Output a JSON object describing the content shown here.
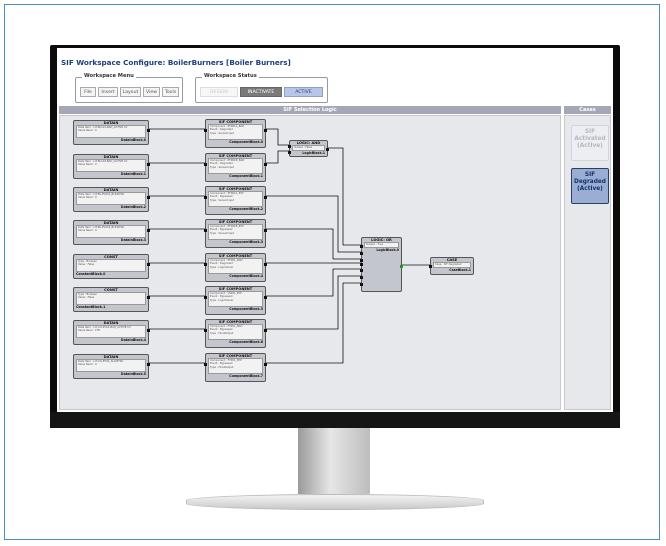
{
  "app": {
    "title": "SIF Workspace Configure: BoilerBurners [Boiler Burners]"
  },
  "workspace_menu": {
    "label": "Workspace Menu",
    "items": [
      "File",
      "Insert",
      "Layout",
      "View",
      "Tools"
    ]
  },
  "workspace_status": {
    "label": "Workspace Status",
    "items": [
      "DESIGN",
      "INACTIVATE",
      "ACTIVE"
    ]
  },
  "panels": {
    "logic_title": "SIF Selection Logic",
    "cases_title": "Cases"
  },
  "cases": [
    {
      "lines": [
        "SIF",
        "Activated",
        "(Active)"
      ],
      "state": "inactive"
    },
    {
      "lines": [
        "SIF",
        "Degraded",
        "(Active)"
      ],
      "state": "active"
    }
  ],
  "colors": {
    "title": "#1c3f7a",
    "panel_header": "#a4a8b6",
    "canvas": "#e6e8ec",
    "case_active": "#9aaed4",
    "status_active": "#b7c6e6",
    "status_inactivate": "#7a7a7a",
    "port_output": "#1e9a2a"
  },
  "data_blocks": [
    {
      "title": "DATAIN",
      "row1": "Data Item : LIT-BL101-BAD_ACTIVE.CV",
      "row2": "Value Read : 0",
      "name": "DataInBlock.0"
    },
    {
      "title": "DATAIN",
      "row1": "Data Item : LIT-BL102-BAD_ACTIVE.CV",
      "row2": "Value Read : 0",
      "name": "DataInBlock.1"
    },
    {
      "title": "DATAIN",
      "row1": "Data Item : LIT-BL-PV001_BLR.BYSR",
      "row2": "Value Read : 0",
      "name": "DataInBlock.2"
    },
    {
      "title": "DATAIN",
      "row1": "Data Item : LIT-BL-PV002_BLR.BYSR",
      "row2": "Value Read : 0",
      "name": "DataInBlock.3"
    },
    {
      "title": "CONST",
      "row1": "Type : Boolean",
      "row2": "Value : False",
      "name": "ConstantBlock.0"
    },
    {
      "title": "CONST",
      "row1": "Type : Boolean",
      "row2": "Value : False",
      "name": "ConstantBlock.1"
    },
    {
      "title": "DATAIN",
      "row1": "Data Item : LIT-CO-PV01-BAD_ACTIVE.CV",
      "row2": "Value Read : 1FB",
      "name": "DataInBlock.4"
    },
    {
      "title": "DATAIN",
      "row1": "Data Item : LIT-CO-PV02_SLR.BYSR",
      "row2": "Value Read : 0",
      "name": "DataInBlock.5"
    }
  ],
  "component_blocks": [
    {
      "title": "SIF COMPONENT",
      "component": "Component : PT001A_BAD",
      "event": "Event : Degraded",
      "type": "Type : SensorInput",
      "name": "ComponentBlock.0"
    },
    {
      "title": "SIF COMPONENT",
      "component": "Component : PT001B_BAD",
      "event": "Event : Degraded",
      "type": "Type : SensorInput",
      "name": "ComponentBlock.1"
    },
    {
      "title": "SIF COMPONENT",
      "component": "Component : PT001A_BYP",
      "event": "Event : Bypassed",
      "type": "Type : SensorInput",
      "name": "ComponentBlock.2"
    },
    {
      "title": "SIF COMPONENT",
      "component": "Component : PT001B_BYP",
      "event": "Event : Bypassed",
      "type": "Type : SensorInput",
      "name": "ComponentBlock.3"
    },
    {
      "title": "SIF COMPONENT",
      "component": "Component : PT001_BAD",
      "event": "Event : Degraded",
      "type": "Type : LogicSolver",
      "name": "ComponentBlock.4"
    },
    {
      "title": "SIF COMPONENT",
      "component": "Component : LS001_BYP",
      "event": "Event : Bypassed",
      "type": "Type : LogicSolver",
      "name": "ComponentBlock.5"
    },
    {
      "title": "SIF COMPONENT",
      "component": "Component : FY001_BAD",
      "event": "Event : Bypassed",
      "type": "Type : FinalOutput",
      "name": "ComponentBlock.6"
    },
    {
      "title": "SIF COMPONENT",
      "component": "Component : FY001_BYP",
      "event": "Event : Bypassed",
      "type": "Type : FinalOutput",
      "name": "ComponentBlock.7"
    }
  ],
  "logic_and": {
    "title": "LOGIC: AND",
    "row1": "Output : False",
    "name": "LogicBlock.1"
  },
  "logic_or": {
    "title": "LOGIC: OR",
    "row1": "Output : True",
    "name": "LogicBlock.0"
  },
  "case_block": {
    "title": "CASE",
    "row1": "Case : SIF Degraded",
    "name": "CaseBlock.1"
  }
}
